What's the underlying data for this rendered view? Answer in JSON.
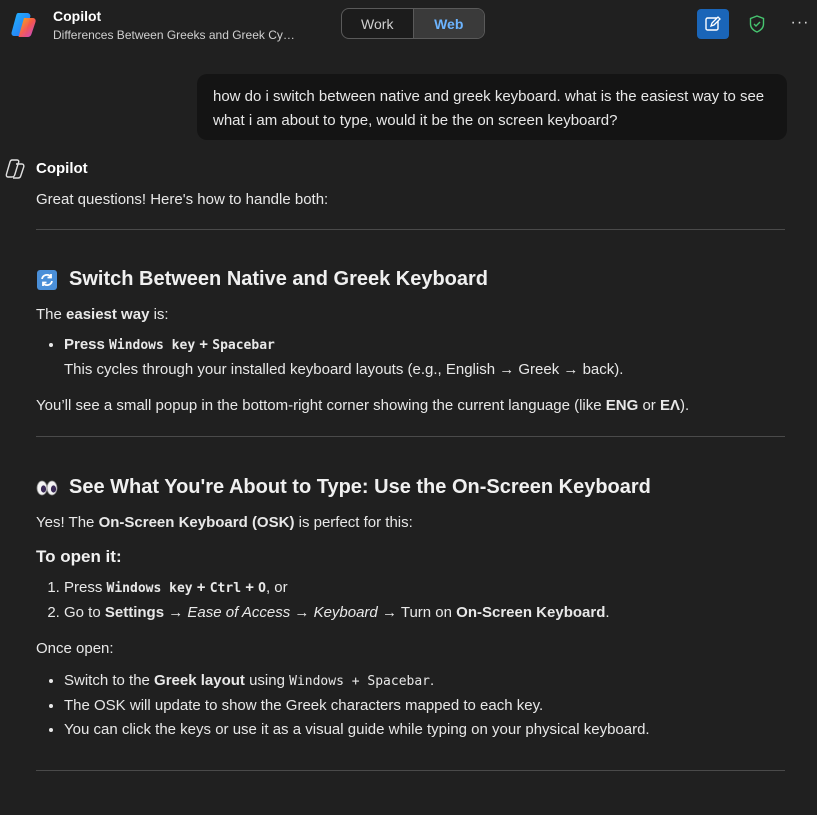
{
  "header": {
    "app_name": "Copilot",
    "conversation_title": "Differences Between Greeks and Greek Cy…",
    "mode_toggle": {
      "work_label": "Work",
      "web_label": "Web",
      "selected": "Web"
    },
    "accent_color": "#1a65b8",
    "active_tab_color": "#6cb4ff"
  },
  "user_message": "how do i switch between native and greek keyboard.  what is the easiest way to see what i am about to type, would it be the on screen keyboard?",
  "assistant": {
    "name": "Copilot",
    "intro": "Great questions! Here's how to handle both:",
    "section1": {
      "emoji": "arrows-cycle-icon",
      "heading": "Switch Between Native and Greek Keyboard",
      "lead_pre": "The ",
      "lead_bold": "easiest way",
      "lead_post": " is:",
      "bullet_press": "Press ",
      "bullet_key1": "Windows key",
      "bullet_plus": " + ",
      "bullet_key2": "Spacebar",
      "bullet_sub": "This cycles through your installed keyboard layouts (e.g., English → Greek → back).",
      "note_pre": "You’ll see a small popup in the bottom-right corner showing the current language (like ",
      "note_b1": "ENG",
      "note_mid": " or ",
      "note_b2": "EΛ",
      "note_post": ")."
    },
    "section2": {
      "emoji": "eyes-icon",
      "heading": "See What You're About to Type: Use the On-Screen Keyboard",
      "lead_pre": "Yes! The ",
      "lead_bold": "On-Screen Keyboard (OSK)",
      "lead_post": " is perfect for this:",
      "subheading": "To open it:",
      "step1_pre": "Press ",
      "step1_k1": "Windows key",
      "step1_plus1": " + ",
      "step1_k2": "Ctrl",
      "step1_plus2": " + ",
      "step1_k3": "O",
      "step1_post": ", or",
      "step2_pre": "Go to ",
      "step2_settings": "Settings",
      "step2_arrow1": " → ",
      "step2_ease": "Ease of Access",
      "step2_arrow2": " → ",
      "step2_keyboard": "Keyboard",
      "step2_arrow3": " → Turn on ",
      "step2_osk": "On-Screen Keyboard",
      "step2_post": ".",
      "once_open": "Once open:",
      "b1_pre": "Switch to the ",
      "b1_bold": "Greek layout",
      "b1_mid": " using ",
      "b1_code": "Windows + Spacebar",
      "b1_post": ".",
      "b2": "The OSK will update to show the Greek characters mapped to each key.",
      "b3": "You can click the keys or use it as a visual guide while typing on your physical keyboard."
    }
  }
}
